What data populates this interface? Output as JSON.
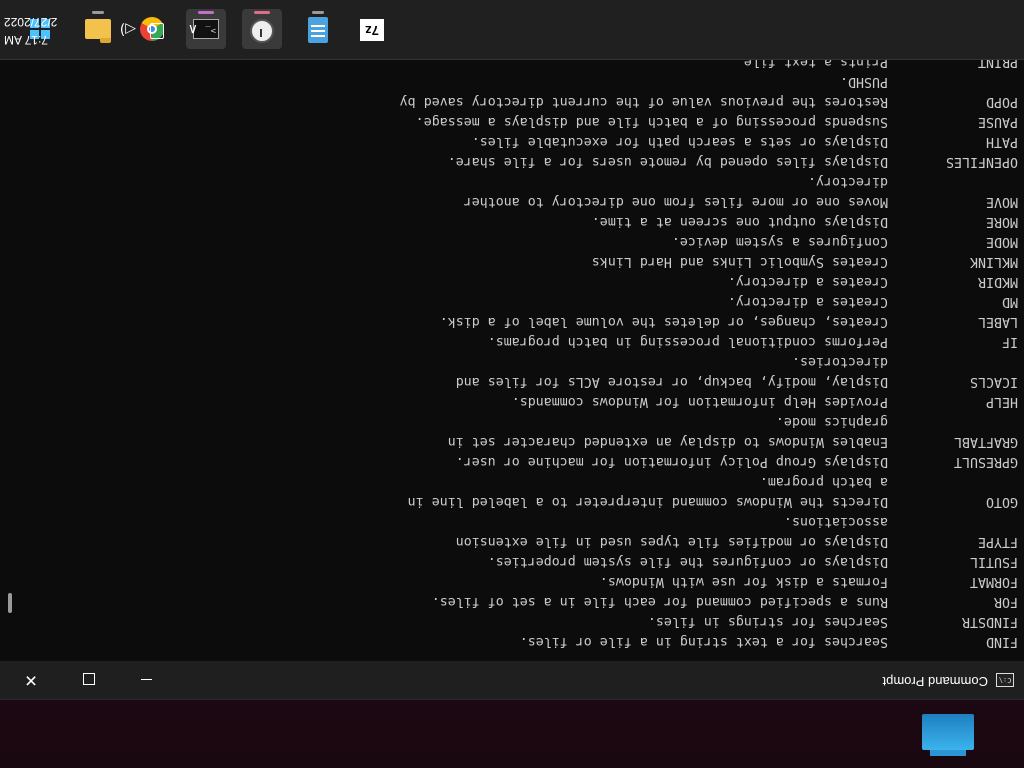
{
  "window": {
    "title": "Command Prompt",
    "icon_text": "C:\\",
    "minimize_label": "—",
    "close_label": "✕"
  },
  "console_lines": [
    {
      "cmd": "FIND",
      "desc": "Searches for a text string in a file or files."
    },
    {
      "cmd": "FINDSTR",
      "desc": "Searches for strings in files."
    },
    {
      "cmd": "FOR",
      "desc": "Runs a specified command for each file in a set of files."
    },
    {
      "cmd": "FORMAT",
      "desc": "Formats a disk for use with Windows."
    },
    {
      "cmd": "FSUTIL",
      "desc": "Displays or configures the file system properties."
    },
    {
      "cmd": "FTYPE",
      "desc": "Displays or modifies file types used in file extension"
    },
    {
      "cmd": "",
      "desc": "associations."
    },
    {
      "cmd": "GOTO",
      "desc": "Directs the Windows command interpreter to a labeled line in"
    },
    {
      "cmd": "",
      "desc": "a batch program."
    },
    {
      "cmd": "GPRESULT",
      "desc": "Displays Group Policy information for machine or user."
    },
    {
      "cmd": "GRAFTABL",
      "desc": "Enables Windows to display an extended character set in"
    },
    {
      "cmd": "",
      "desc": "graphics mode."
    },
    {
      "cmd": "HELP",
      "desc": "Provides Help information for Windows commands."
    },
    {
      "cmd": "ICACLS",
      "desc": "Display, modify, backup, or restore ACLs for files and"
    },
    {
      "cmd": "",
      "desc": "directories."
    },
    {
      "cmd": "IF",
      "desc": "Performs conditional processing in batch programs."
    },
    {
      "cmd": "LABEL",
      "desc": "Creates, changes, or deletes the volume label of a disk."
    },
    {
      "cmd": "MD",
      "desc": "Creates a directory."
    },
    {
      "cmd": "MKDIR",
      "desc": "Creates a directory."
    },
    {
      "cmd": "MKLINK",
      "desc": "Creates Symbolic Links and Hard Links"
    },
    {
      "cmd": "MODE",
      "desc": "Configures a system device."
    },
    {
      "cmd": "MORE",
      "desc": "Displays output one screen at a time."
    },
    {
      "cmd": "MOVE",
      "desc": "Moves one or more files from one directory to another"
    },
    {
      "cmd": "",
      "desc": "directory."
    },
    {
      "cmd": "OPENFILES",
      "desc": "Displays files opened by remote users for a file share."
    },
    {
      "cmd": "PATH",
      "desc": "Displays or sets a search path for executable files."
    },
    {
      "cmd": "PAUSE",
      "desc": "Suspends processing of a batch file and displays a message."
    },
    {
      "cmd": "POPD",
      "desc": "Restores the previous value of the current directory saved by"
    },
    {
      "cmd": "",
      "desc": "PUSHD."
    },
    {
      "cmd": "PRINT",
      "desc": "Prints a text file."
    }
  ],
  "taskbar": {
    "apps": [
      "start-button",
      "file-explorer",
      "chrome",
      "command-prompt",
      "alarms-clock",
      "notepad",
      "7zip"
    ],
    "zip_label": "7z",
    "term_label": ">_",
    "chevron": "∧",
    "volume": "◁)",
    "time": "7:17 AM",
    "date": "2/27/2022"
  },
  "colors": {
    "console_bg": "#0c0c0c",
    "console_text": "#cccccc",
    "taskbar_bg": "#202020",
    "accent": "#4cc2ff"
  }
}
